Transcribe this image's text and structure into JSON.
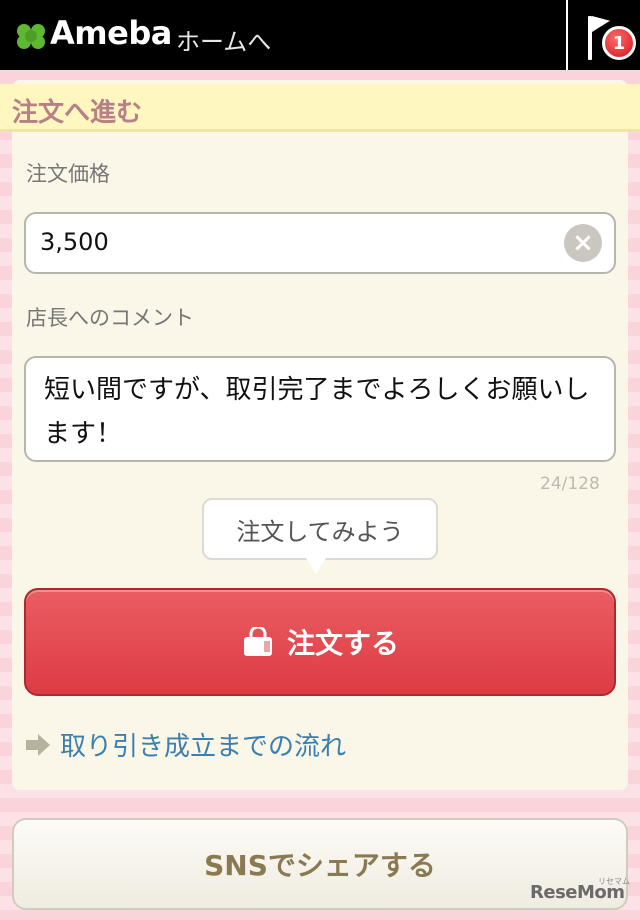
{
  "header": {
    "logo_text": "Ameba",
    "home_link": "ホームへ",
    "notification_count": "1"
  },
  "section": {
    "title": "注文へ進む"
  },
  "form": {
    "price_label": "注文価格",
    "price_value": "3,500",
    "comment_label": "店長へのコメント",
    "comment_value": "短い間ですが、取引完了までよろしくお願いします！",
    "char_counter": "24/128"
  },
  "tooltip": {
    "text": "注文してみよう"
  },
  "actions": {
    "order_button": "注文する",
    "flow_link": "取り引き成立までの流れ",
    "share_button": "SNSでシェアする"
  },
  "watermark": {
    "text": "ReseMom",
    "small": "リセマム"
  },
  "colors": {
    "accent_red": "#dc3c43",
    "link_blue": "#3a7fb0",
    "section_title": "#b97f86"
  }
}
